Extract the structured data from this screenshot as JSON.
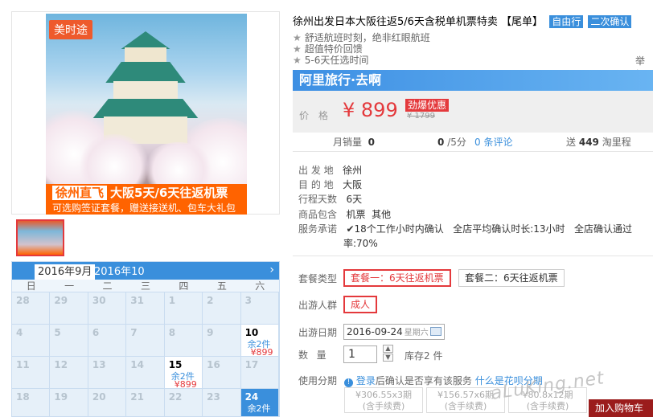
{
  "gallery": {
    "logo": "美时途",
    "banner_tag": "徐州直飞",
    "banner_title": "大阪5天/6天往返机票",
    "banner_sub": "可选购签证套餐，赠送接送机、包车大礼包"
  },
  "calendar": {
    "active_month": "2016年9月",
    "next_month": "2016年10",
    "next_arrow": "›",
    "weekdays": [
      "日",
      "一",
      "二",
      "三",
      "四",
      "五",
      "六"
    ],
    "cells": [
      {
        "d": "28"
      },
      {
        "d": "29"
      },
      {
        "d": "30"
      },
      {
        "d": "31"
      },
      {
        "d": "1"
      },
      {
        "d": "2"
      },
      {
        "d": "3"
      },
      {
        "d": "4"
      },
      {
        "d": "5"
      },
      {
        "d": "6"
      },
      {
        "d": "7"
      },
      {
        "d": "8"
      },
      {
        "d": "9"
      },
      {
        "d": "10",
        "stock": "余2件",
        "price": "¥899"
      },
      {
        "d": "11"
      },
      {
        "d": "12"
      },
      {
        "d": "13"
      },
      {
        "d": "14"
      },
      {
        "d": "15",
        "stock": "余2件",
        "price": "¥899"
      },
      {
        "d": "16"
      },
      {
        "d": "17"
      },
      {
        "d": "18"
      },
      {
        "d": "19"
      },
      {
        "d": "20"
      },
      {
        "d": "21"
      },
      {
        "d": "22"
      },
      {
        "d": "23"
      },
      {
        "d": "24",
        "stock": "余2件"
      }
    ]
  },
  "product": {
    "title": "徐州出发日本大阪往返5/6天含税单机票特卖 【尾单】",
    "tags": [
      "自由行",
      "二次确认"
    ],
    "features": [
      "舒适航班时刻，绝非红眼航班",
      "超值特价回馈",
      "5-6天任选时间"
    ],
    "report": "举报",
    "brand": "阿里旅行·去啊",
    "price_label": "价格",
    "price": "¥ 899",
    "promo": "劲爆优惠",
    "original_price": "¥ 1799"
  },
  "stats": {
    "monthly_label": "月销量",
    "monthly_value": "0",
    "rating_value": "0",
    "rating_suffix": "/5分",
    "reviews": "0 条评论",
    "points_prefix": "送",
    "points_value": "449",
    "points_suffix": "淘里程"
  },
  "info": [
    {
      "label": "出 发 地",
      "value": "徐州"
    },
    {
      "label": "目 的 地",
      "value": "大阪"
    },
    {
      "label": "行程天数",
      "value": "6天"
    },
    {
      "label": "商品包含",
      "value": "机票  其他"
    },
    {
      "label": "服务承诺",
      "value": "18个工作小时内确认   全店平均确认时长:13小时   全店确认通过",
      "value2": "率:70%"
    }
  ],
  "purchase": {
    "package_label": "套餐类型",
    "package_options": [
      "套餐一：6天往返机票",
      "套餐二：6天往返机票"
    ],
    "crowd_label": "出游人群",
    "crowd_option": "成人",
    "date_label": "出游日期",
    "date_value": "2016-09-24",
    "date_weekday": "星期六",
    "qty_label": "数  量",
    "qty_value": "1",
    "stock": "库存2 件",
    "installment_label": "使用分期",
    "installment_login": "登录",
    "installment_text": "后确认是否享有该服务",
    "installment_link": "什么是花呗分期",
    "installments": [
      {
        "amount": "¥306.55x3期",
        "fee": "(含手续费)"
      },
      {
        "amount": "¥156.57x6期",
        "fee": "(含手续费)"
      },
      {
        "amount": "¥80.8x12期",
        "fee": "(含手续费)"
      }
    ],
    "cart_button": "加入购物车"
  },
  "watermark": "aLuKing.net"
}
